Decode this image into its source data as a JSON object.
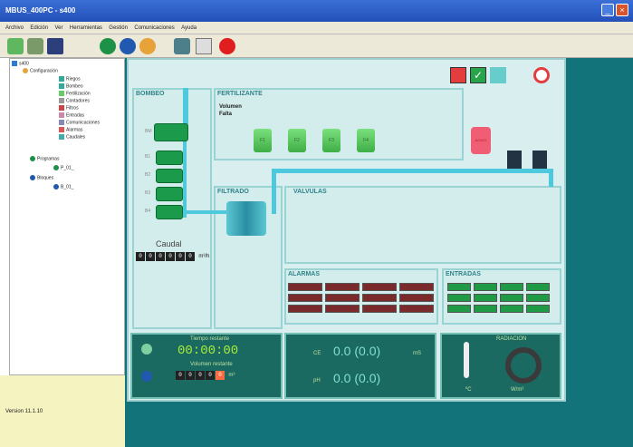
{
  "window": {
    "title": "MBUS_400PC - s400"
  },
  "menu": [
    "Archivo",
    "Edición",
    "Ver",
    "Herramientas",
    "Gestión",
    "Comunicaciones",
    "Ayuda"
  ],
  "tree": {
    "root": "s400",
    "config": "Configuración",
    "children": [
      "Riegos",
      "Bombeo",
      "Fertilización",
      "Contadores",
      "Filtros",
      "Entradas",
      "Comunicaciones",
      "Alarmas",
      "Caudales"
    ],
    "programs": "Programas",
    "program_item": "P_01_",
    "blocks": "Bloques",
    "block_item": "B_01_"
  },
  "version": "Version 11.1.10",
  "panels": {
    "bombeo": "BOMBEO",
    "fertilizante": "FERTILIZANTE",
    "fert_volumen": "Volumen",
    "fert_falta": "Falta",
    "filtrado": "FILTRADO",
    "valvulas": "VALVULAS",
    "alarmas": "ALARMAS",
    "entradas": "ENTRADAS"
  },
  "pumps": [
    "BM",
    "B1",
    "B2",
    "B3",
    "B4"
  ],
  "tanks": [
    "F1",
    "F2",
    "F3",
    "F4"
  ],
  "acid": "ACIDO",
  "caudal": {
    "label": "Caudal",
    "digits": [
      "0",
      "0",
      "0",
      "0",
      "0",
      "0"
    ],
    "unit": "m³/h"
  },
  "timer": {
    "tiempo_label": "Tiempo restante",
    "tiempo": "00:00:00",
    "volumen_label": "Volumen restante",
    "vol_digits": [
      "0",
      "0",
      "0",
      "0",
      "0"
    ],
    "vol_unit": "m³"
  },
  "ce": {
    "label": "CE",
    "value": "0.0 (0.0)",
    "unit": "mS"
  },
  "ph": {
    "label": "pH",
    "value": "0.0 (0.0)"
  },
  "radiacion": {
    "label": "RADIACION",
    "temp_unit": "ºC",
    "rad_unit": "W/m²"
  },
  "colors": {
    "panel_bg": "#d3ecec",
    "dark_panel": "#1b6a61",
    "digits": "#a6eb3a",
    "alarm": "#7a2a2a",
    "entrada": "#1f9a45"
  }
}
